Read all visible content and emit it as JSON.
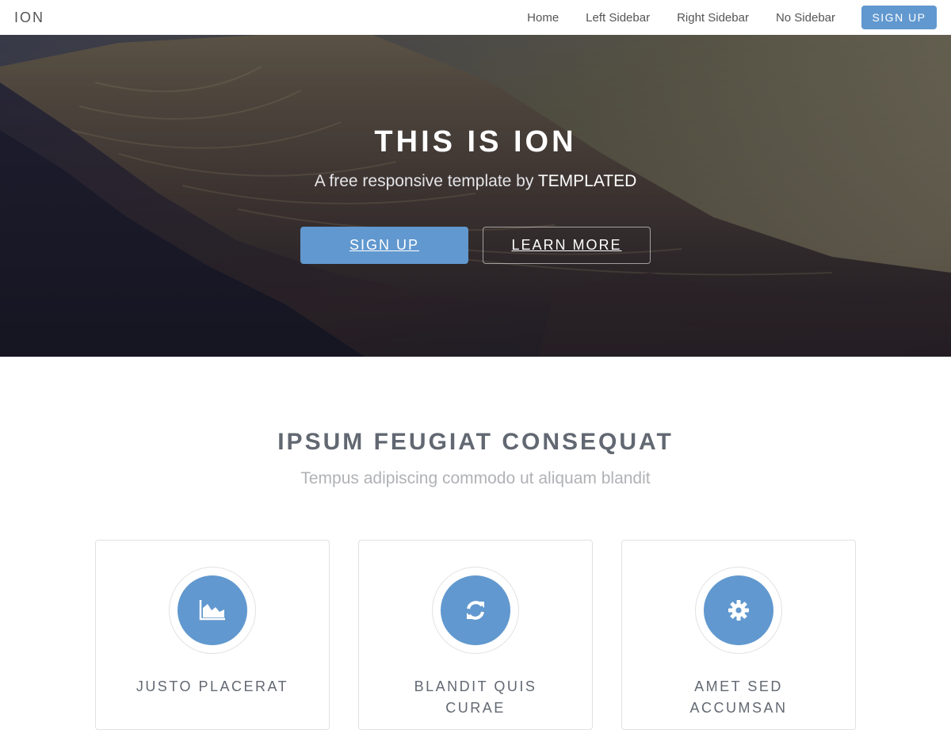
{
  "header": {
    "logo": "ION",
    "nav": [
      "Home",
      "Left Sidebar",
      "Right Sidebar",
      "No Sidebar"
    ],
    "signup_label": "SIGN UP"
  },
  "banner": {
    "title": "THIS IS ION",
    "subtitle_prefix": "A free responsive template by ",
    "subtitle_brand": "TEMPLATED",
    "primary_button": "SIGN UP",
    "secondary_button": "LEARN MORE"
  },
  "section": {
    "title": "IPSUM FEUGIAT CONSEQUAT",
    "subtitle": "Tempus adipiscing commodo ut aliquam blandit"
  },
  "features": [
    {
      "icon": "area-chart-icon",
      "title": "JUSTO PLACERAT"
    },
    {
      "icon": "refresh-icon",
      "title": "BLANDIT QUIS CURAE"
    },
    {
      "icon": "gear-icon",
      "title": "AMET SED ACCUMSAN"
    }
  ],
  "colors": {
    "accent": "#6198cf",
    "heading": "#626872",
    "muted": "#b0b2b6"
  }
}
